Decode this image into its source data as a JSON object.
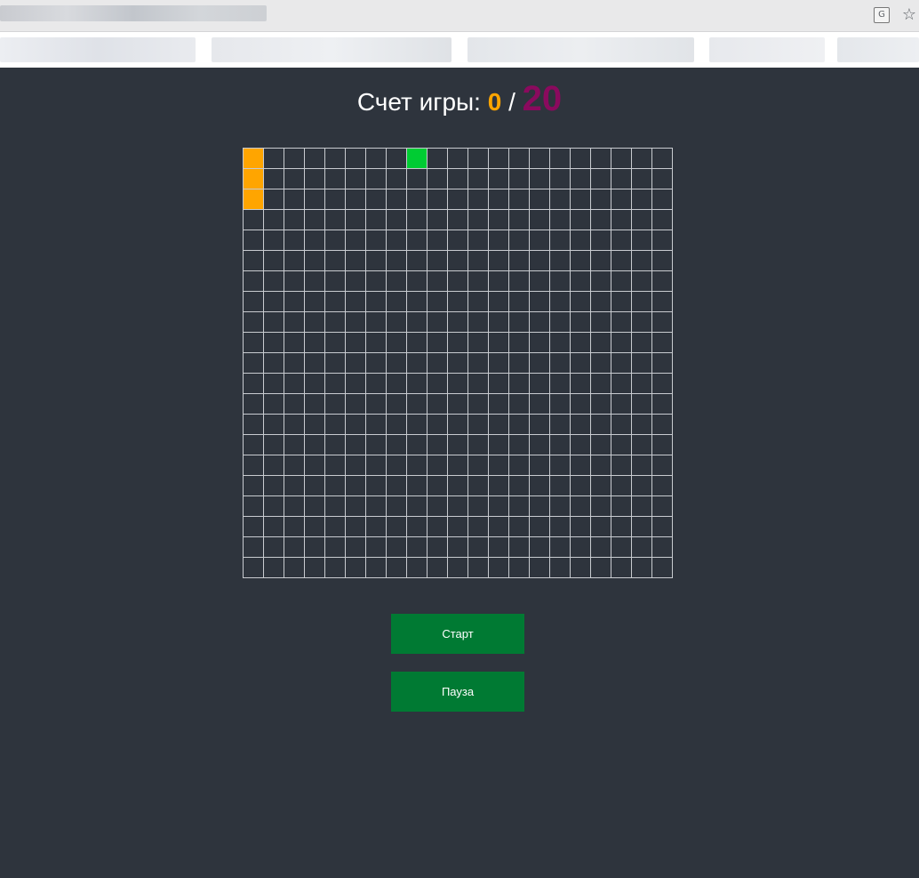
{
  "browser": {
    "translate_icon": "translate-icon",
    "bookmark_icon": "star-icon"
  },
  "score": {
    "label": "Счет игры:",
    "current": "0",
    "separator": "/",
    "goal": "20"
  },
  "board": {
    "columns": 21,
    "rows": 21,
    "snake_cells": [
      [
        0,
        0
      ],
      [
        0,
        1
      ],
      [
        0,
        2
      ]
    ],
    "food_cell": [
      8,
      0
    ],
    "colors": {
      "background": "#2e343d",
      "grid_line": "#c8cbd0",
      "snake": "#ffa500",
      "food": "#00cc33"
    }
  },
  "buttons": {
    "start_label": "Старт",
    "pause_label": "Пауза",
    "color": "#007a33"
  }
}
